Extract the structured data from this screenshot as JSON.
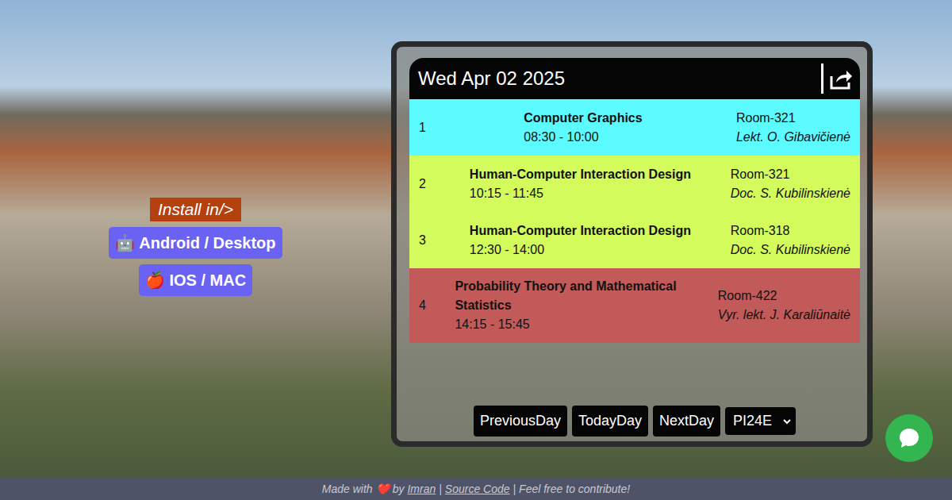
{
  "header": {
    "date": "Wed Apr 02 2025"
  },
  "install": {
    "label": "Install in/>",
    "buttons": [
      "🤖 Android / Desktop",
      "🍎 IOS / MAC"
    ]
  },
  "lessons": [
    {
      "number": "1",
      "subject": "Computer Graphics",
      "time": "08:30 - 10:00",
      "room": "Room-321",
      "teacher": "Lekt. O. Gibavičienė",
      "color": "#5cfbff"
    },
    {
      "number": "2",
      "subject": "Human-Computer Interaction Design",
      "time": "10:15 - 11:45",
      "room": "Room-321",
      "teacher": "Doc. S. Kubilinskienė",
      "color": "#d4fb5c"
    },
    {
      "number": "3",
      "subject": "Human-Computer Interaction Design",
      "time": "12:30 - 14:00",
      "room": "Room-318",
      "teacher": "Doc. S. Kubilinskienė",
      "color": "#d4fb5c"
    },
    {
      "number": "4",
      "subject": "Probability Theory and Mathematical Statistics",
      "time": "14:15 - 15:45",
      "room": "Room-422",
      "teacher": "Vyr. lekt. J. Karaliūnaitė",
      "color": "#c15a58"
    }
  ],
  "nav": {
    "buttons": [
      "PreviousDay",
      "TodayDay",
      "NextDay"
    ],
    "group": "PI24E"
  },
  "footer": [
    {
      "text": "Made with",
      "link": false
    },
    {
      "text": "❤️",
      "link": false
    },
    {
      "text": "by",
      "link": false
    },
    {
      "text": "Imran",
      "link": true
    },
    {
      "text": "|",
      "link": false
    },
    {
      "text": "Source Code",
      "link": true
    },
    {
      "text": "| Feel free to contribute!",
      "link": false
    }
  ]
}
